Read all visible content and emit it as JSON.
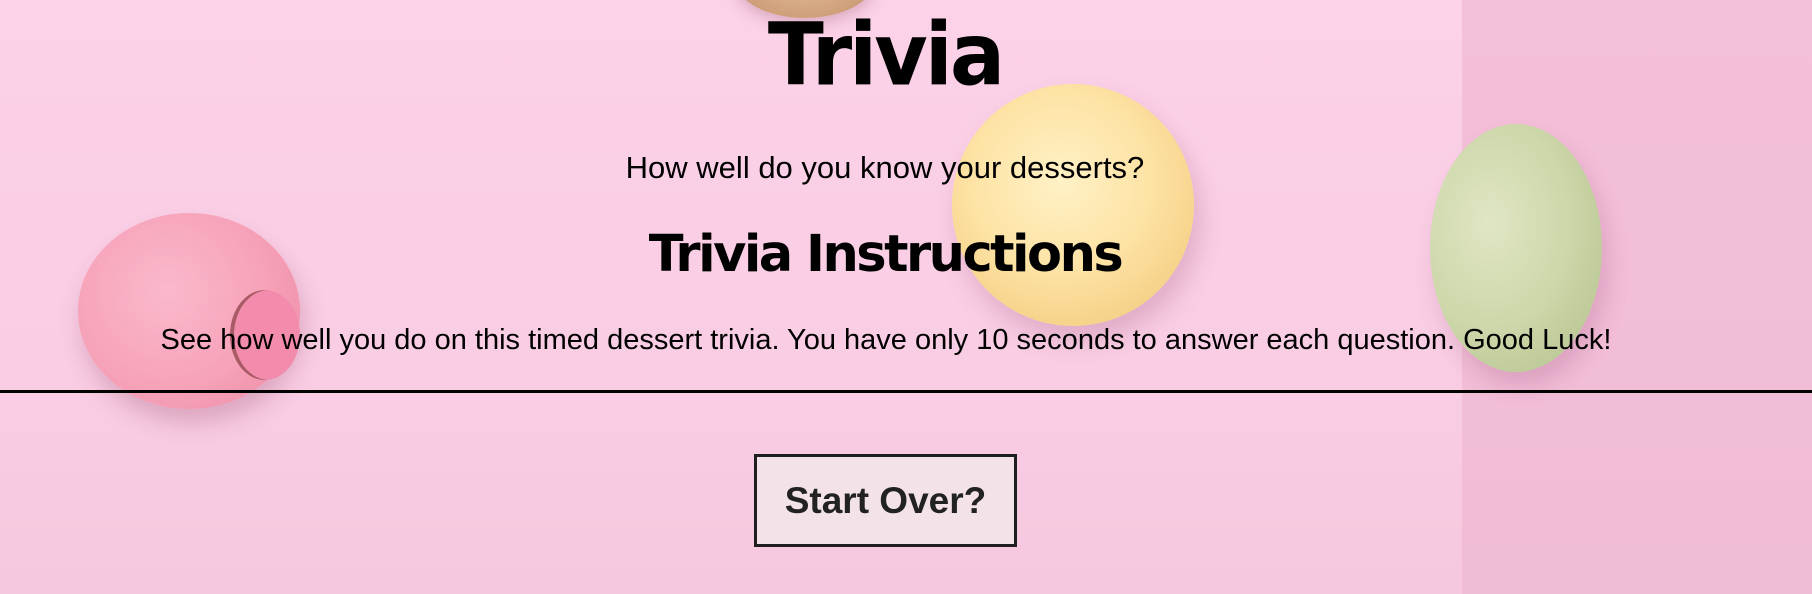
{
  "page": {
    "title": "Trivia",
    "subtitle": "How well do you know your desserts?"
  },
  "instructions": {
    "heading": "Trivia Instructions",
    "text": "See how well you do on this timed dessert trivia. You have only 10 seconds to answer each question. Good Luck!"
  },
  "actions": {
    "start_over_label": "Start Over?"
  },
  "colors": {
    "background": "#f9cfe5",
    "text": "#000000",
    "button_background": "#f3e3e8",
    "button_border": "#1f1f1f"
  }
}
